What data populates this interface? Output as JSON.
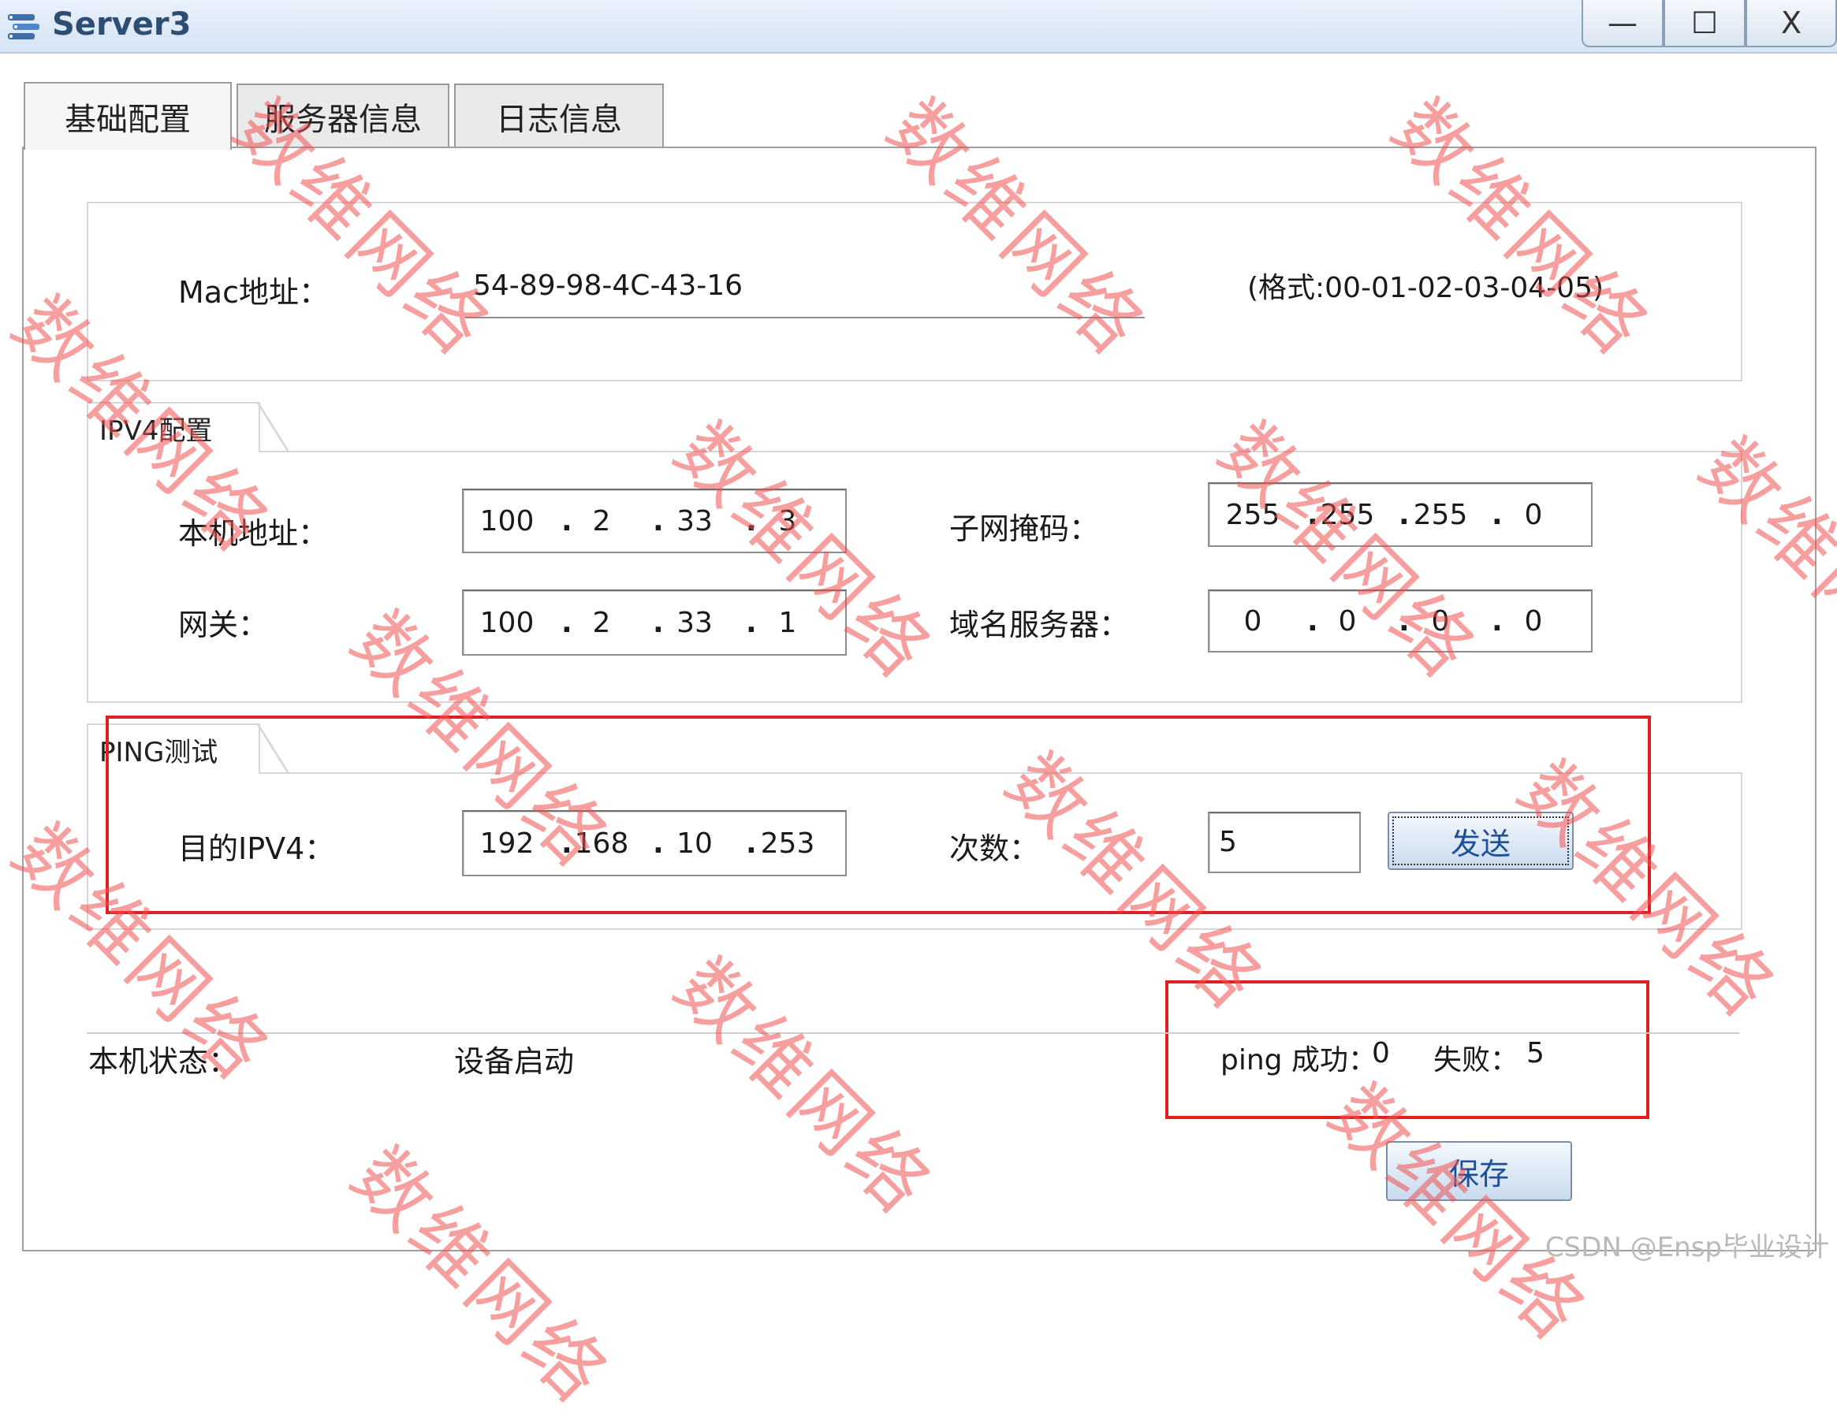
{
  "window": {
    "title": "Server3",
    "minimize_glyph": "—",
    "maximize_glyph": "☐",
    "close_glyph": "X"
  },
  "tabs": [
    {
      "label": "基础配置",
      "active": true
    },
    {
      "label": "服务器信息",
      "active": false
    },
    {
      "label": "日志信息",
      "active": false
    }
  ],
  "mac": {
    "label": "Mac地址：",
    "value": "54-89-98-4C-43-16",
    "format_hint": "(格式:00-01-02-03-04-05)"
  },
  "ipv4": {
    "section_title": "IPV4配置",
    "host_label": "本机地址：",
    "host": [
      "100",
      "2",
      "33",
      "3"
    ],
    "mask_label": "子网掩码：",
    "mask": [
      "255",
      "255",
      "255",
      "0"
    ],
    "gateway_label": "网关：",
    "gateway": [
      "100",
      "2",
      "33",
      "1"
    ],
    "dns_label": "域名服务器：",
    "dns": [
      "0",
      "0",
      "0",
      "0"
    ]
  },
  "ping": {
    "section_title": "PING测试",
    "dest_label": "目的IPV4：",
    "dest": [
      "192",
      "168",
      "10",
      "253"
    ],
    "count_label": "次数：",
    "count": "5",
    "send_label": "发送"
  },
  "status": {
    "label": "本机状态：",
    "value": "设备启动",
    "success_label": "ping 成功：",
    "success_value": "0",
    "fail_label": "失败：",
    "fail_value": "5"
  },
  "save_label": "保存",
  "watermark_text": "数维网络",
  "credit": "CSDN @Ensp毕业设计",
  "colors": {
    "highlight_box": "#e02020",
    "watermark": "#f05050",
    "button_text": "#1d4f9a"
  }
}
